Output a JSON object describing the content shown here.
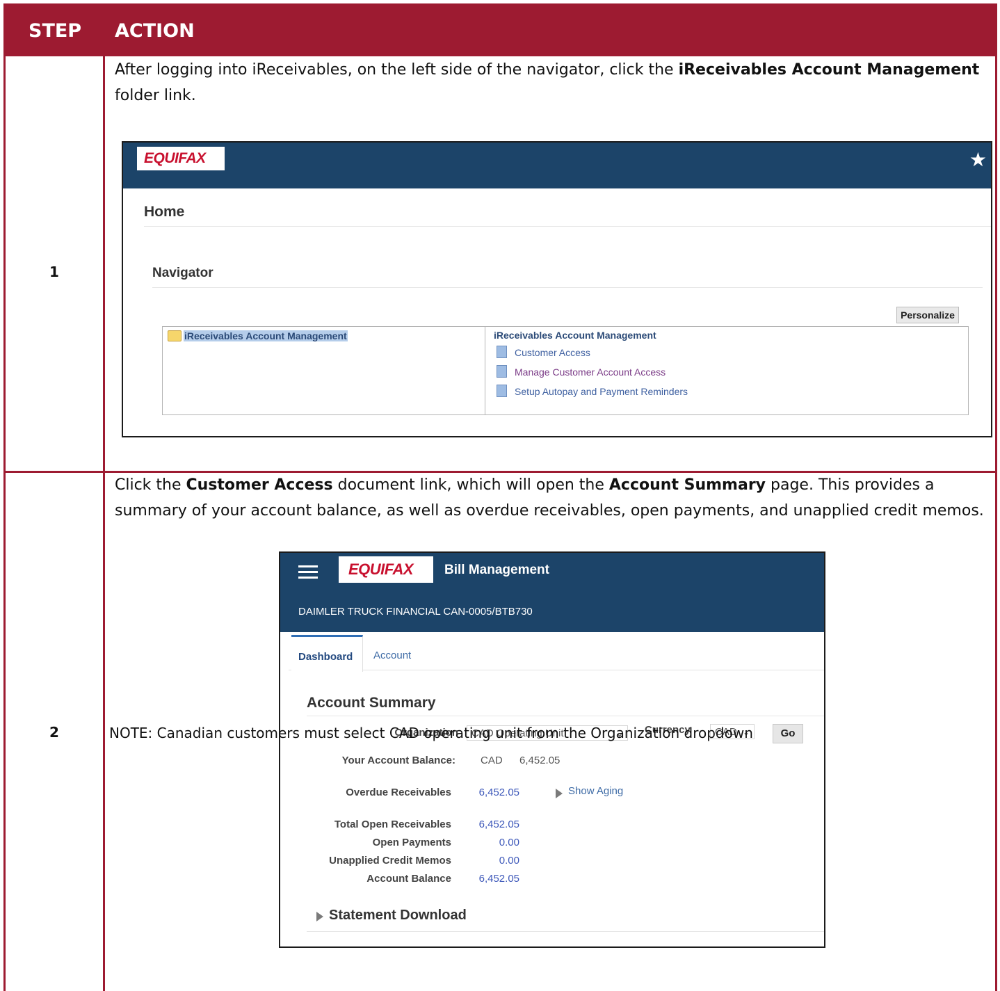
{
  "table": {
    "header": {
      "step": "STEP",
      "action": "ACTION"
    },
    "rows": [
      {
        "step": "1",
        "action_parts": [
          "After logging into iReceivables, on the left side of the navigator, click the ",
          "iReceivables Account Management",
          " folder link."
        ]
      },
      {
        "step": "2",
        "action_parts": [
          "Click the ",
          "Customer Access",
          " document link, which will open the ",
          "Account Summary",
          " page. This provides a summary of your account balance, as well as overdue receivables, open payments, and unapplied credit memos."
        ],
        "note": "NOTE: Canadian customers must select CAD operating unit from the Organization dropdown"
      }
    ]
  },
  "screenshot1": {
    "logo": "EQUIFAX",
    "star_icon": "star-icon",
    "home_title": "Home",
    "navigator_title": "Navigator",
    "personalize": "Personalize",
    "folder_link": "iReceivables Account Management",
    "right_title": "iReceivables Account Management",
    "links": [
      "Customer Access",
      "Manage Customer Account Access",
      "Setup Autopay and Payment Reminders"
    ]
  },
  "screenshot2": {
    "logo": "EQUIFAX",
    "app_title": "Bill Management",
    "customer": "DAIMLER TRUCK FINANCIAL CAN-0005/BTB730",
    "tabs": [
      "Dashboard",
      "Account"
    ],
    "section_title": "Account Summary",
    "organization_label": "Organization",
    "organization_value": "CAD Operating Unit",
    "currency_label": "Currency",
    "currency_value": "CAD",
    "go": "Go",
    "balance_label": "Your Account Balance:",
    "balance_currency": "CAD",
    "balance_value": "6,452.05",
    "overdue_label": "Overdue Receivables",
    "overdue_value": "6,452.05",
    "show_aging": "Show Aging",
    "summary": [
      {
        "label": "Total Open Receivables",
        "value": "6,452.05"
      },
      {
        "label": "Open Payments",
        "value": "0.00"
      },
      {
        "label": "Unapplied Credit Memos",
        "value": "0.00"
      },
      {
        "label": "Account Balance",
        "value": "6,452.05"
      }
    ],
    "statement_download": "Statement Download"
  }
}
